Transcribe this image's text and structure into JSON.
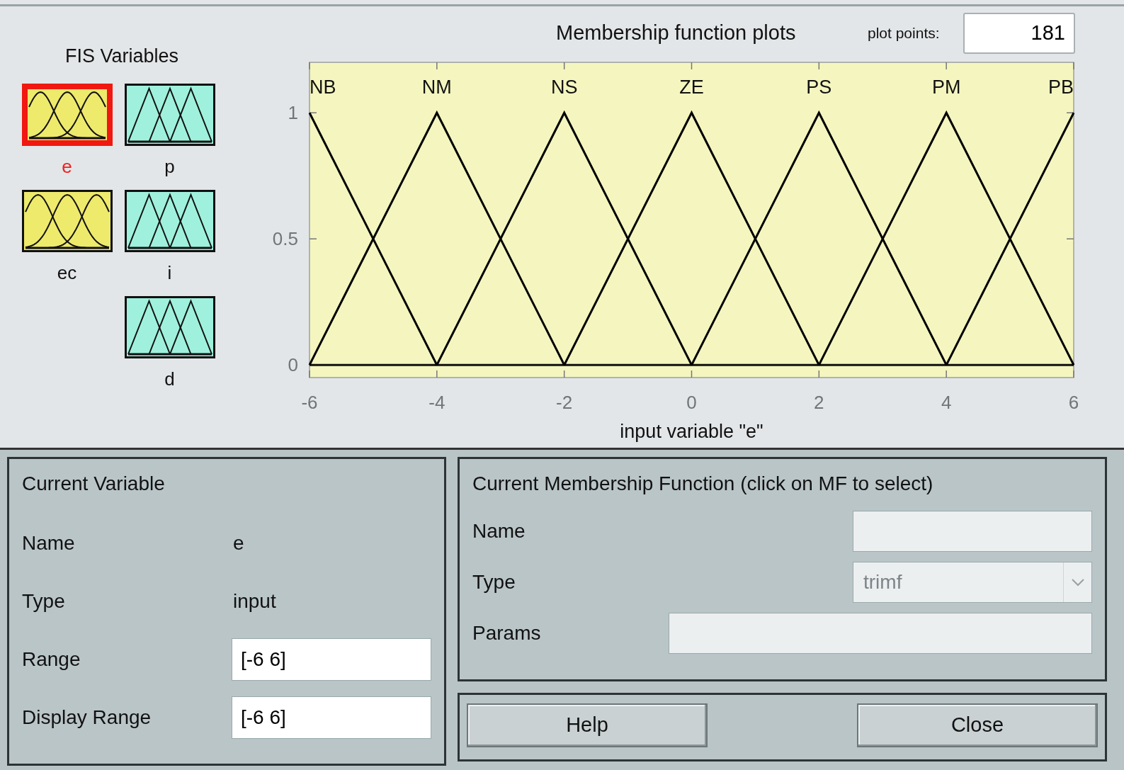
{
  "fis_variables": {
    "title": "FIS Variables",
    "variables": [
      {
        "name": "e",
        "kind": "input",
        "selected": true
      },
      {
        "name": "p",
        "kind": "output",
        "selected": false
      },
      {
        "name": "ec",
        "kind": "input",
        "selected": false
      },
      {
        "name": "i",
        "kind": "output",
        "selected": false
      },
      {
        "name": "d",
        "kind": "output",
        "selected": false
      }
    ]
  },
  "plot": {
    "title": "Membership function plots",
    "plot_points_label": "plot points:",
    "plot_points": "181",
    "chart_data": {
      "type": "line",
      "xlabel": "input variable \"e\"",
      "x": [
        -6,
        -4,
        -2,
        0,
        2,
        4,
        6
      ],
      "xlim": [
        -6,
        6
      ],
      "ylim": [
        -0.05,
        1.2
      ],
      "xticks": [
        -6,
        -4,
        -2,
        0,
        2,
        4,
        6
      ],
      "yticks": [
        0,
        0.5,
        1
      ],
      "series": [
        {
          "name": "NB",
          "color": "#000000",
          "values": [
            1,
            0,
            null,
            null,
            null,
            null,
            null
          ]
        },
        {
          "name": "NM",
          "color": "#000000",
          "values": [
            0,
            1,
            0,
            null,
            null,
            null,
            null
          ]
        },
        {
          "name": "NS",
          "color": "#000000",
          "values": [
            null,
            0,
            1,
            0,
            null,
            null,
            null
          ]
        },
        {
          "name": "ZE",
          "color": "#000000",
          "values": [
            null,
            null,
            0,
            1,
            0,
            null,
            null
          ]
        },
        {
          "name": "PS",
          "color": "#000000",
          "values": [
            null,
            null,
            null,
            0,
            1,
            0,
            null
          ]
        },
        {
          "name": "PM",
          "color": "#000000",
          "values": [
            null,
            null,
            null,
            null,
            0,
            1,
            0
          ]
        },
        {
          "name": "PB",
          "color": "#000000",
          "values": [
            null,
            null,
            null,
            null,
            null,
            0,
            1
          ]
        }
      ]
    }
  },
  "current_variable": {
    "title": "Current Variable",
    "rows": [
      {
        "label": "Name",
        "kind": "text",
        "value": "e"
      },
      {
        "label": "Type",
        "kind": "text",
        "value": "input"
      },
      {
        "label": "Range",
        "kind": "field",
        "value": "[-6 6]"
      },
      {
        "label": "Display Range",
        "kind": "field",
        "value": "[-6 6]"
      }
    ]
  },
  "current_mf": {
    "title": "Current Membership Function (click on MF to select)",
    "rows": [
      {
        "label": "Name",
        "kind": "field",
        "disabled": true
      },
      {
        "label": "Type",
        "kind": "dropdown",
        "value": "trimf",
        "disabled": true
      },
      {
        "label": "Params",
        "kind": "wide-field",
        "disabled": true
      }
    ]
  },
  "buttons": [
    "Help",
    "Close"
  ]
}
